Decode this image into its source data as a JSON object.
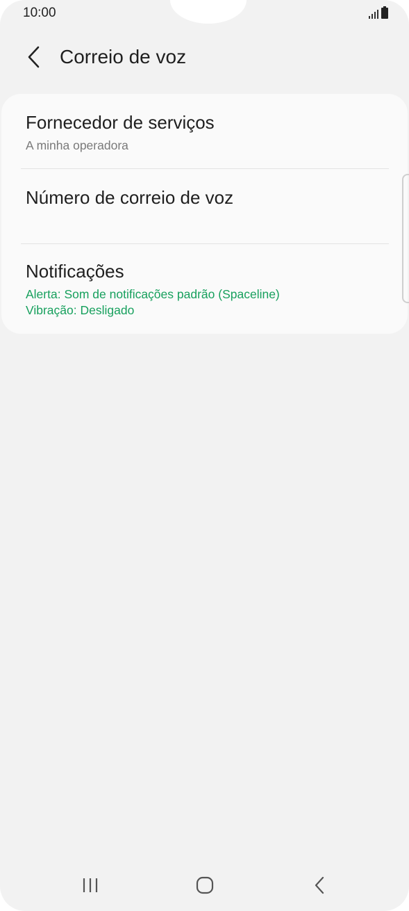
{
  "status_bar": {
    "time": "10:00",
    "icons": [
      "signal-icon",
      "battery-icon"
    ]
  },
  "header": {
    "title": "Correio de voz",
    "back_icon": "back-arrow-icon"
  },
  "settings": [
    {
      "title": "Fornecedor de serviços",
      "subtitle": "A minha operadora"
    },
    {
      "title": "Número de correio de voz"
    },
    {
      "title": "Notificações",
      "line1": "Alerta: Som de notificações padrão (Spaceline)",
      "line2": "Vibração: Desligado"
    }
  ],
  "colors": {
    "background": "#f2f2f2",
    "card": "#fafafa",
    "accent": "#17a05d",
    "subtitle_gray": "#7a7a7a"
  },
  "nav_bar": {
    "buttons": [
      "recent-apps-icon",
      "home-icon",
      "back-icon"
    ]
  }
}
